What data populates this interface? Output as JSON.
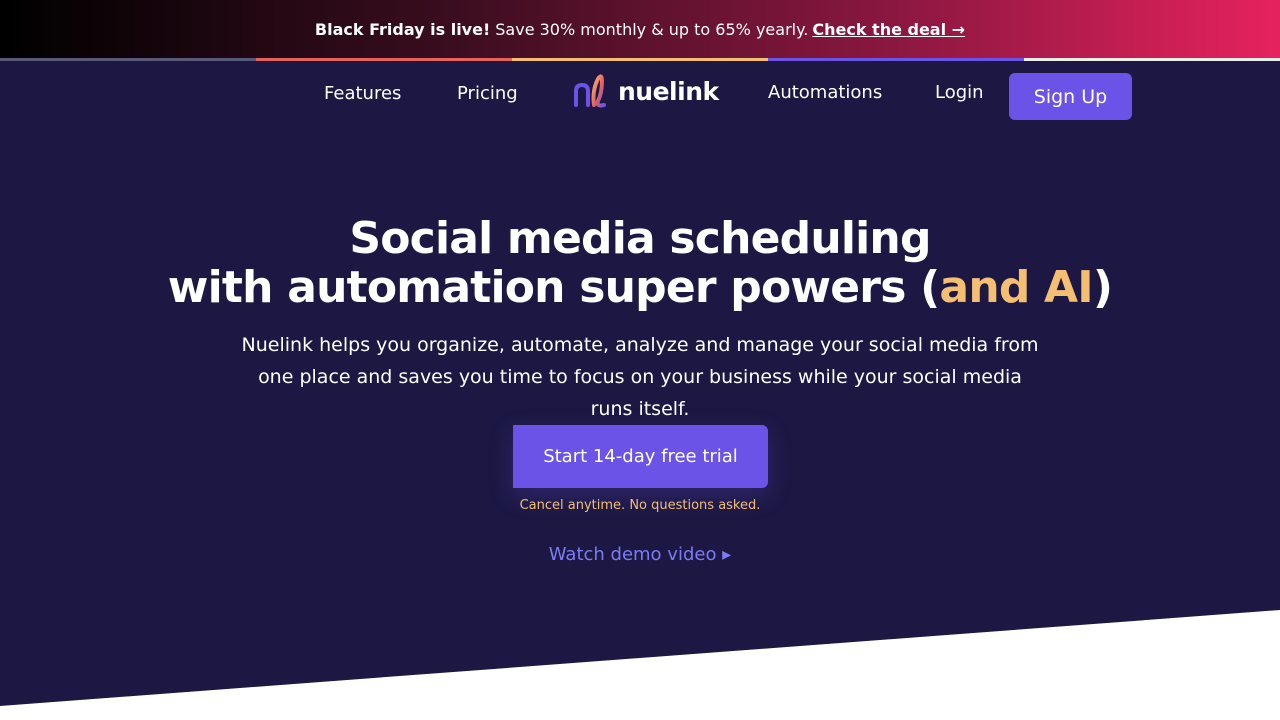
{
  "promo": {
    "bold": "Black Friday is live!",
    "message": "Save 30% monthly & up to 65% yearly.",
    "link": "Check the deal →"
  },
  "stripe_colors": [
    "#58597a",
    "#e8615f",
    "#f4be73",
    "#6b53e8",
    "#eeeeee"
  ],
  "nav": {
    "features": "Features",
    "pricing": "Pricing",
    "logo_text": "nuelink",
    "automations": "Automations",
    "login": "Login",
    "signup": "Sign Up"
  },
  "hero": {
    "title_line1": "Social media scheduling",
    "title_line2_pre": "with automation super powers (",
    "title_accent": "and AI",
    "title_line2_post": ")",
    "subtitle": "Nuelink helps you organize, automate, analyze and manage your social media from one place and saves you time to focus on your business while your social media runs itself.",
    "cta": "Start 14-day free trial",
    "cta_note": "Cancel anytime. No questions asked.",
    "demo": "Watch demo video ▸"
  },
  "colors": {
    "background": "#1c1843",
    "primary": "#6b53e8",
    "accent": "#f4be73",
    "link": "#7b7cf5"
  }
}
